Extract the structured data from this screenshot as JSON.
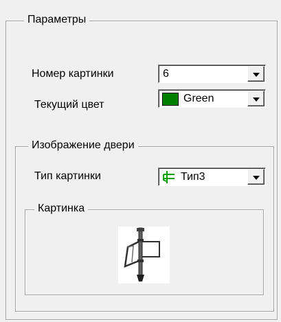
{
  "params_group": {
    "title": "Параметры",
    "picture_number_label": "Номер картинки",
    "picture_number_value": "6",
    "current_color_label": "Текущий цвет",
    "current_color_value": "Green",
    "current_color_hex": "#008000"
  },
  "door_group": {
    "title": "Изображение двери",
    "picture_type_label": "Тип картинки",
    "picture_type_value": "Тип3",
    "picture_type_icon": "door-type-icon",
    "picture_group": {
      "title": "Картинка",
      "preview_icon": "door-picture-icon"
    }
  }
}
